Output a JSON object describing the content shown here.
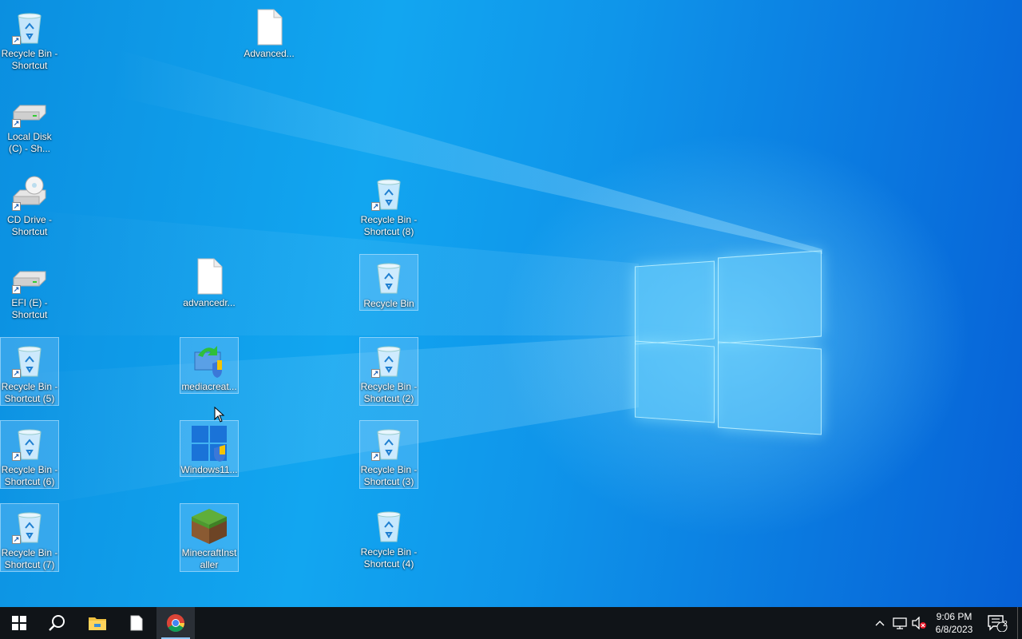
{
  "desktop": {
    "icons": [
      {
        "id": "rb-shortcut",
        "label": "Recycle Bin - Shortcut",
        "type": "recycle-bin",
        "shortcut": true,
        "selected": false
      },
      {
        "id": "advanced-doc",
        "label": "Advanced...",
        "type": "file",
        "shortcut": false,
        "selected": false
      },
      {
        "id": "local-disk",
        "label": "Local Disk (C) - Sh...",
        "type": "drive",
        "shortcut": true,
        "selected": false
      },
      {
        "id": "cd-drive",
        "label": "CD Drive - Shortcut",
        "type": "cd-drive",
        "shortcut": true,
        "selected": false
      },
      {
        "id": "rb-shortcut-8",
        "label": "Recycle Bin - Shortcut (8)",
        "type": "recycle-bin",
        "shortcut": true,
        "selected": false
      },
      {
        "id": "efi",
        "label": "EFI (E) - Shortcut",
        "type": "drive",
        "shortcut": true,
        "selected": false
      },
      {
        "id": "advancedr",
        "label": "advancedr...",
        "type": "file",
        "shortcut": false,
        "selected": false
      },
      {
        "id": "recycle-bin",
        "label": "Recycle Bin",
        "type": "recycle-bin",
        "shortcut": false,
        "selected": true
      },
      {
        "id": "rb-shortcut-5",
        "label": "Recycle Bin - Shortcut (5)",
        "type": "recycle-bin",
        "shortcut": true,
        "selected": true
      },
      {
        "id": "mediacreat",
        "label": "mediacreat...",
        "type": "media-creation",
        "shortcut": false,
        "selected": true
      },
      {
        "id": "rb-shortcut-2",
        "label": "Recycle Bin - Shortcut (2)",
        "type": "recycle-bin",
        "shortcut": true,
        "selected": true
      },
      {
        "id": "rb-shortcut-6",
        "label": "Recycle Bin - Shortcut (6)",
        "type": "recycle-bin",
        "shortcut": true,
        "selected": true
      },
      {
        "id": "windows11",
        "label": "Windows11...",
        "type": "windows11",
        "shortcut": false,
        "selected": true
      },
      {
        "id": "rb-shortcut-3",
        "label": "Recycle Bin - Shortcut (3)",
        "type": "recycle-bin",
        "shortcut": true,
        "selected": true
      },
      {
        "id": "rb-shortcut-7",
        "label": "Recycle Bin - Shortcut (7)",
        "type": "recycle-bin",
        "shortcut": true,
        "selected": true
      },
      {
        "id": "minecraft",
        "label": "MinecraftInstaller",
        "type": "minecraft",
        "shortcut": false,
        "selected": true
      },
      {
        "id": "rb-shortcut-4",
        "label": "Recycle Bin - Shortcut (4)",
        "type": "recycle-bin",
        "shortcut": false,
        "selected": false
      }
    ]
  },
  "taskbar": {
    "buttons": [
      {
        "name": "start-button",
        "icon": "windows-logo-icon"
      },
      {
        "name": "search-button",
        "icon": "search-icon"
      },
      {
        "name": "file-explorer-button",
        "icon": "folder-icon"
      },
      {
        "name": "notepad-button",
        "icon": "document-icon"
      },
      {
        "name": "chrome-button",
        "icon": "chrome-icon",
        "active": true
      }
    ],
    "tray": {
      "time": "9:06 PM",
      "date": "6/8/2023",
      "notifications_count": "2"
    }
  },
  "colors": {
    "taskbar_bg": "#101418",
    "desktop_blue": "#0f95ea",
    "selection": "#96d2ff"
  }
}
